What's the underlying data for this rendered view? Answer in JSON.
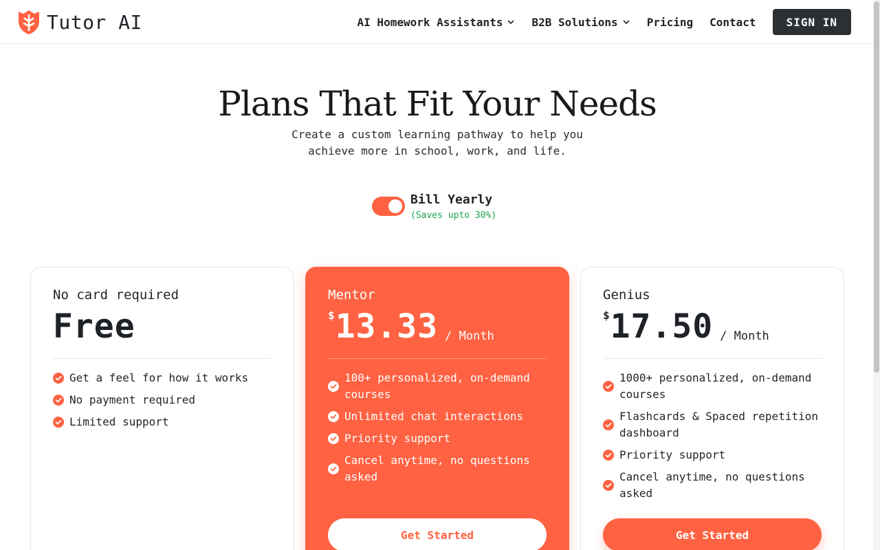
{
  "header": {
    "brand": "Tutor AI",
    "brand_color": "#ff6242",
    "logo_icon": "shield-logo-icon",
    "nav": [
      {
        "label": "AI Homework Assistants",
        "has_dropdown": true
      },
      {
        "label": "B2B Solutions",
        "has_dropdown": true
      },
      {
        "label": "Pricing",
        "has_dropdown": false
      },
      {
        "label": "Contact",
        "has_dropdown": false
      }
    ],
    "signin_label": "SIGN IN"
  },
  "hero": {
    "title": "Plans That Fit Your Needs",
    "subtitle_line1": "Create a custom learning pathway to help you",
    "subtitle_line2": "achieve more in school, work, and life."
  },
  "billing": {
    "toggle_on": true,
    "label": "Bill Yearly",
    "savings": "(Saves upto 30%)",
    "savings_color": "#18a34a"
  },
  "plans": [
    {
      "label": "No card required",
      "currency": "",
      "amount": "Free",
      "period": "",
      "features": [
        "Get a feel for how it works",
        "No payment required",
        "Limited support"
      ],
      "cta": ""
    },
    {
      "label": "Mentor",
      "currency": "$",
      "amount": "13.33",
      "period": "/ Month",
      "features": [
        "100+ personalized, on-demand courses",
        "Unlimited chat interactions",
        "Priority support",
        "Cancel anytime, no questions asked"
      ],
      "cta": "Get Started",
      "highlighted": true
    },
    {
      "label": "Genius",
      "currency": "$",
      "amount": "17.50",
      "period": "/ Month",
      "features": [
        "1000+ personalized, on-demand courses",
        "Flashcards & Spaced repetition dashboard",
        "Priority support",
        "Cancel anytime, no questions asked"
      ],
      "cta": "Get Started"
    }
  ]
}
